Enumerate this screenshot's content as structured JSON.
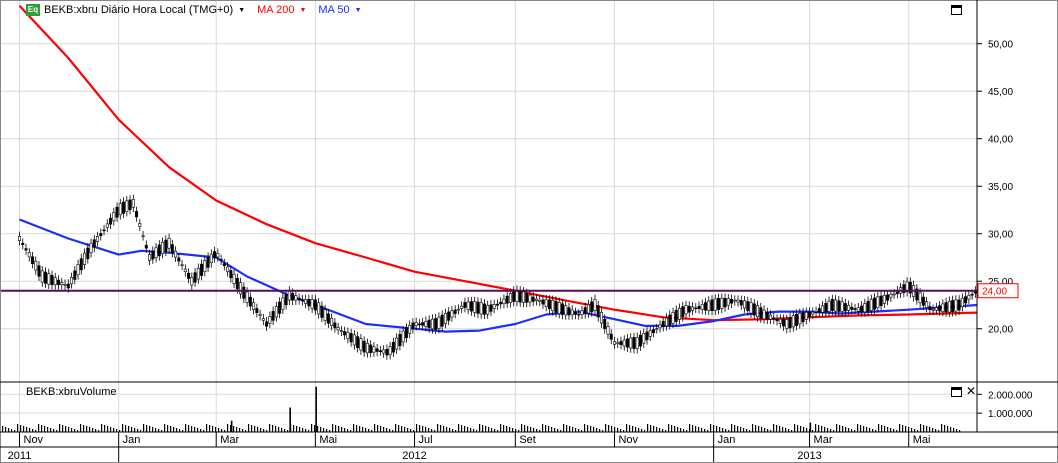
{
  "header": {
    "symbol_label": "BEKB:xbru Diário Hora Local (TMG+0)",
    "ma200_label": "MA 200",
    "ma50_label": "MA 50",
    "eq_icon_text": "Eq",
    "dropdown_icon": "caret-down-icon"
  },
  "volume_header": {
    "label": "BEKB:xbruVolume"
  },
  "colors": {
    "price": "#000000",
    "ma200": "#ff0000",
    "ma50": "#1e2cff",
    "last_price_line": "#5a0a5a",
    "last_price_box": "#ff0000",
    "grid": "#d9d9d9"
  },
  "chart_data": [
    {
      "type": "line",
      "title": "",
      "series": [
        {
          "name": "BEKB:xbru",
          "role": "price",
          "x": [
            "2011-11-01",
            "2011-11-15",
            "2011-12-01",
            "2011-12-15",
            "2012-01-01",
            "2012-01-10",
            "2012-01-20",
            "2012-02-01",
            "2012-02-15",
            "2012-03-01",
            "2012-03-15",
            "2012-04-01",
            "2012-04-15",
            "2012-05-01",
            "2012-05-15",
            "2012-06-01",
            "2012-06-15",
            "2012-07-01",
            "2012-07-15",
            "2012-08-01",
            "2012-08-15",
            "2012-09-01",
            "2012-09-15",
            "2012-10-01",
            "2012-10-10",
            "2012-10-20",
            "2012-11-01",
            "2012-11-15",
            "2012-12-01",
            "2012-12-15",
            "2013-01-01",
            "2013-01-15",
            "2013-02-01",
            "2013-02-15",
            "2013-03-01",
            "2013-03-15",
            "2013-04-01",
            "2013-04-15",
            "2013-05-01",
            "2013-05-15",
            "2013-06-01",
            "2013-06-12"
          ],
          "values": [
            29.5,
            25.5,
            24.5,
            28.5,
            32.5,
            33.2,
            27.5,
            29.0,
            25.0,
            28.0,
            24.5,
            20.5,
            23.5,
            22.5,
            20.0,
            18.0,
            17.5,
            20.5,
            20.5,
            22.5,
            22.0,
            23.5,
            23.0,
            22.0,
            21.5,
            22.5,
            18.5,
            18.5,
            20.5,
            22.0,
            22.5,
            23.0,
            21.5,
            20.5,
            21.5,
            22.5,
            22.0,
            23.0,
            24.5,
            22.0,
            22.5,
            24.0
          ]
        },
        {
          "name": "MA 200",
          "role": "ma200",
          "x": [
            "2011-11-01",
            "2011-12-01",
            "2012-01-01",
            "2012-02-01",
            "2012-03-01",
            "2012-04-01",
            "2012-05-01",
            "2012-06-01",
            "2012-07-01",
            "2012-08-01",
            "2012-09-01",
            "2012-10-01",
            "2012-11-01",
            "2012-12-01",
            "2013-01-01",
            "2013-02-01",
            "2013-03-01",
            "2013-04-01",
            "2013-05-01",
            "2013-06-12"
          ],
          "values": [
            54.0,
            48.5,
            42.0,
            37.0,
            33.5,
            31.0,
            29.0,
            27.5,
            26.0,
            25.0,
            24.0,
            23.0,
            22.0,
            21.2,
            20.9,
            21.0,
            21.2,
            21.4,
            21.5,
            21.7
          ]
        },
        {
          "name": "MA 50",
          "role": "ma50",
          "x": [
            "2011-11-01",
            "2011-12-01",
            "2012-01-01",
            "2012-01-15",
            "2012-02-01",
            "2012-03-01",
            "2012-03-20",
            "2012-04-15",
            "2012-05-01",
            "2012-06-01",
            "2012-07-01",
            "2012-07-20",
            "2012-08-10",
            "2012-09-01",
            "2012-09-20",
            "2012-10-10",
            "2012-11-01",
            "2012-11-20",
            "2012-12-10",
            "2013-01-01",
            "2013-01-20",
            "2013-02-10",
            "2013-03-01",
            "2013-03-20",
            "2013-04-10",
            "2013-05-01",
            "2013-06-12"
          ],
          "values": [
            31.5,
            29.5,
            27.8,
            28.2,
            28.0,
            27.5,
            25.5,
            23.5,
            22.5,
            20.5,
            20.0,
            19.7,
            19.8,
            20.5,
            21.5,
            21.8,
            21.0,
            20.3,
            20.3,
            20.8,
            21.5,
            21.8,
            21.8,
            21.6,
            21.8,
            22.0,
            22.5
          ]
        }
      ],
      "last_price": 24.0,
      "last_price_label": "24,00",
      "xlabel": "",
      "ylabel": "",
      "x_range": [
        "2011-10-20",
        "2013-06-12"
      ],
      "ylim": [
        14.5,
        54.6
      ],
      "y_ticks": [
        20,
        25,
        30,
        35,
        40,
        45,
        50
      ],
      "y_tick_labels": [
        "20,00",
        "25,00",
        "30,00",
        "35,00",
        "40,00",
        "45,00",
        "50,00"
      ],
      "grid": true,
      "legend": "top-left",
      "axis_position": "right"
    },
    {
      "type": "bar",
      "title": "",
      "series": [
        {
          "name": "BEKB:xbruVolume",
          "role": "volume",
          "x": [
            "2012-03-10",
            "2012-04-15",
            "2012-05-01",
            "2013-03-01"
          ],
          "values": [
            600000,
            1300000,
            2400000,
            500000
          ]
        }
      ],
      "ylim": [
        0,
        2600000
      ],
      "y_ticks": [
        1000000,
        2000000
      ],
      "y_tick_labels": [
        "1.000.000",
        "2.000.000"
      ],
      "grid": true
    }
  ],
  "time_axis": {
    "months": [
      {
        "label": "Nov",
        "date": "2011-11-01"
      },
      {
        "label": "Jan",
        "date": "2012-01-01"
      },
      {
        "label": "Mar",
        "date": "2012-03-01"
      },
      {
        "label": "Mai",
        "date": "2012-05-01"
      },
      {
        "label": "Jul",
        "date": "2012-07-01"
      },
      {
        "label": "Set",
        "date": "2012-09-01"
      },
      {
        "label": "Nov",
        "date": "2012-11-01"
      },
      {
        "label": "Jan",
        "date": "2013-01-01"
      },
      {
        "label": "Mar",
        "date": "2013-03-01"
      },
      {
        "label": "Mai",
        "date": "2013-05-01"
      }
    ],
    "years": [
      {
        "label": "2011",
        "date": "2011-11-01"
      },
      {
        "label": "2012",
        "date": "2012-07-01"
      },
      {
        "label": "2013",
        "date": "2013-03-01"
      }
    ],
    "year_breaks": [
      "2012-01-01",
      "2013-01-01"
    ]
  }
}
